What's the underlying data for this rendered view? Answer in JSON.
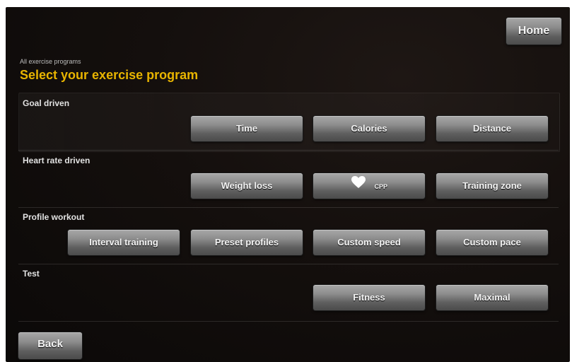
{
  "header": {
    "breadcrumb": "All exercise programs",
    "title": "Select your exercise program",
    "home_label": "Home"
  },
  "sections": {
    "goal": {
      "label": "Goal driven",
      "buttons": [
        "Time",
        "Calories",
        "Distance"
      ]
    },
    "heart": {
      "label": "Heart rate driven",
      "buttons": [
        "Weight loss",
        "CPP",
        "Training zone"
      ]
    },
    "profile": {
      "label": "Profile workout",
      "buttons": [
        "Interval training",
        "Preset profiles",
        "Custom speed",
        "Custom pace"
      ]
    },
    "test": {
      "label": "Test",
      "buttons": [
        "Fitness",
        "Maximal"
      ]
    }
  },
  "footer": {
    "back_label": "Back"
  },
  "colors": {
    "title": "#e8b400",
    "background": "#140f0d",
    "button": "#8d8d8d"
  }
}
